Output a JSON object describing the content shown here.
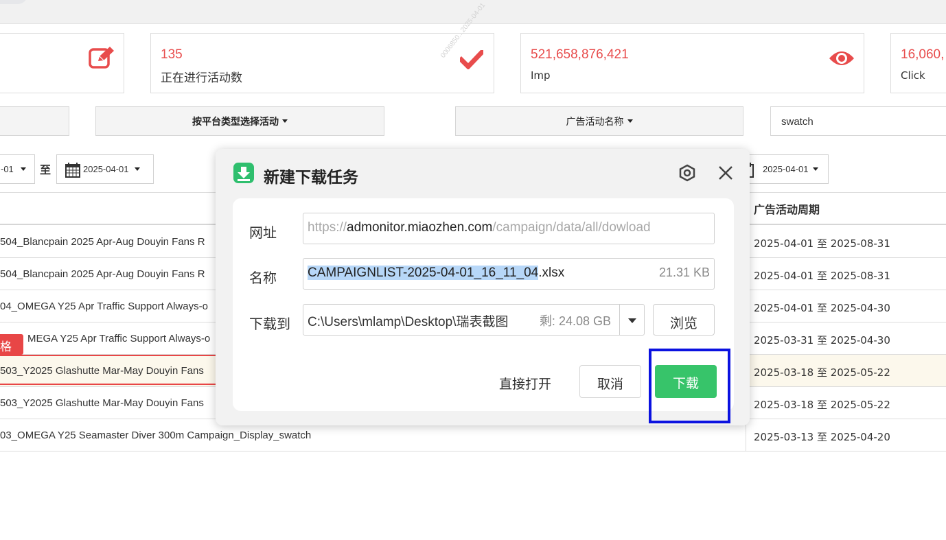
{
  "stats": [
    {
      "value": "",
      "label": "",
      "icon": "edit-icon"
    },
    {
      "value": "135",
      "label": "正在进行活动数",
      "icon": "check-icon"
    },
    {
      "value": "521,658,876,421",
      "label": "Imp",
      "icon": "eye-icon"
    },
    {
      "value": "16,060,",
      "label": "Click",
      "icon": ""
    }
  ],
  "filters": {
    "platform_type": "按平台类型选择活动",
    "campaign_name": "广告活动名称",
    "search_value": "swatch"
  },
  "dates": {
    "start_fragment": "-01",
    "separator": "至",
    "end": "2025-04-01",
    "right_end": "2025-04-01"
  },
  "table": {
    "period_header": "广告活动周期",
    "rows": [
      {
        "name": "504_Blancpain 2025 Apr-Aug Douyin Fans R",
        "period": "2025-04-01 至 2025-08-31"
      },
      {
        "name": "504_Blancpain 2025 Apr-Aug Douyin Fans R",
        "period": "2025-04-01 至 2025-08-31"
      },
      {
        "name": "04_OMEGA Y25 Apr Traffic Support Always-o",
        "period": "2025-04-01 至 2025-04-30"
      },
      {
        "name": "MEGA Y25 Apr Traffic Support Always-o",
        "period": "2025-03-31 至 2025-04-30"
      },
      {
        "name": "503_Y2025 Glashutte Mar-May Douyin Fans",
        "period": "2025-03-18 至 2025-05-22"
      },
      {
        "name": "503_Y2025 Glashutte Mar-May Douyin Fans",
        "period": "2025-03-18 至 2025-05-22"
      },
      {
        "name": "03_OMEGA Y25 Seamaster Diver 300m Campaign_Display_swatch",
        "period": "2025-03-13 至 2025-04-20"
      }
    ]
  },
  "red_tag": "格",
  "watermark": "0006850...2025-04-01",
  "dialog": {
    "title": "新建下载任务",
    "url_label": "网址",
    "url_prefix": "https://",
    "url_host": "admonitor.miaozhen.com",
    "url_path": "/campaign/data/all/dowload",
    "name_label": "名称",
    "name_selected": "CAMPAIGNLIST-2025-04-01_16_11_04",
    "name_ext": ".xlsx",
    "file_size": "21.31 KB",
    "save_label": "下载到",
    "save_path": "C:\\Users\\mlamp\\Desktop\\瑞表截图",
    "free_space": "剩: 24.08 GB",
    "browse": "浏览",
    "open_direct": "直接打开",
    "cancel": "取消",
    "download": "下载"
  },
  "colors": {
    "accent_red": "#e84c4c",
    "download_green": "#37c46a",
    "highlight_blue": "#0b12e0"
  }
}
